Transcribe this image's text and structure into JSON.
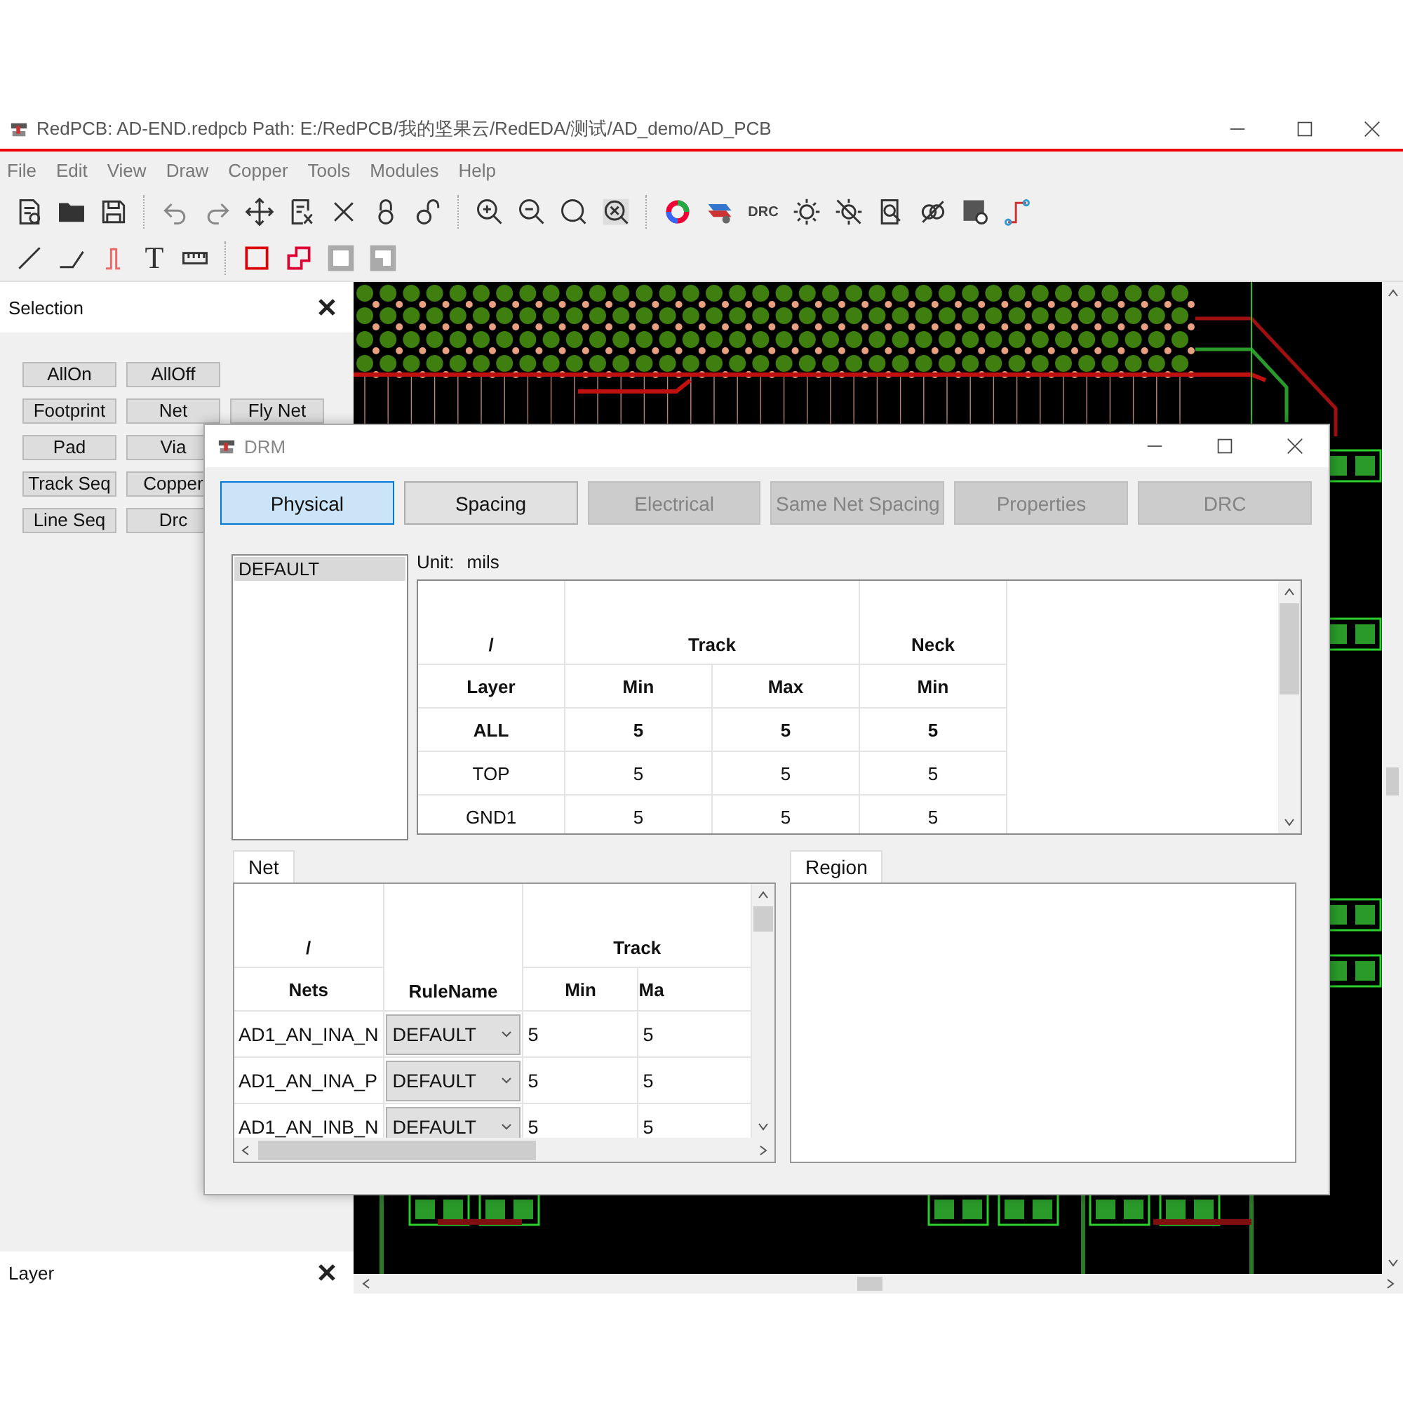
{
  "window": {
    "title": "RedPCB: AD-END.redpcb Path: E:/RedPCB/我的坚果云/RedEDA/测试/AD_demo/AD_PCB"
  },
  "menu": [
    "File",
    "Edit",
    "View",
    "Draw",
    "Copper",
    "Tools",
    "Modules",
    "Help"
  ],
  "toolbar": {
    "drc_label": "DRC",
    "text_tool_label": "T"
  },
  "selection_panel": {
    "title": "Selection",
    "button_rows": [
      [
        "AllOn",
        "AllOff"
      ],
      [
        "Footprint",
        "Net",
        "Fly Net"
      ],
      [
        "Pad",
        "Via"
      ],
      [
        "Track Seq",
        "Copper"
      ],
      [
        "Line Seq",
        "Drc"
      ]
    ]
  },
  "layer_panel": {
    "title": "Layer"
  },
  "drm_dialog": {
    "title": "DRM",
    "tabs": [
      {
        "label": "Physical",
        "selected": true,
        "disabled": false
      },
      {
        "label": "Spacing",
        "selected": false,
        "disabled": false
      },
      {
        "label": "Electrical",
        "selected": false,
        "disabled": true
      },
      {
        "label": "Same Net Spacing",
        "selected": false,
        "disabled": true
      },
      {
        "label": "Properties",
        "selected": false,
        "disabled": true
      },
      {
        "label": "DRC",
        "selected": false,
        "disabled": true
      }
    ],
    "rule_list": [
      {
        "label": "DEFAULT",
        "selected": true
      }
    ],
    "unit_label": "Unit:",
    "unit_value": "mils",
    "physical_table": {
      "header_top": [
        "/",
        "Track",
        "Neck"
      ],
      "header": [
        "Layer",
        "Min",
        "Max",
        "Min"
      ],
      "rows": [
        {
          "kind": "all",
          "cells": [
            "ALL",
            "5",
            "5",
            "5"
          ]
        },
        {
          "kind": "layer",
          "cells": [
            "TOP",
            "5",
            "5",
            "5"
          ]
        },
        {
          "kind": "layer",
          "cells": [
            "GND1",
            "5",
            "5",
            "5"
          ]
        }
      ]
    },
    "net_tab": "Net",
    "region_tab": "Region",
    "net_table": {
      "header_top": [
        "/",
        "RuleName",
        "Track"
      ],
      "header": [
        "Nets",
        "Min",
        "Ma"
      ],
      "rows": [
        {
          "net": "AD1_AN_INA_N",
          "rule": "DEFAULT",
          "min": "5",
          "max": "5"
        },
        {
          "net": "AD1_AN_INA_P",
          "rule": "DEFAULT",
          "min": "5",
          "max": "5"
        },
        {
          "net": "AD1_AN_INB_N",
          "rule": "DEFAULT",
          "min": "5",
          "max": "5"
        }
      ]
    }
  }
}
